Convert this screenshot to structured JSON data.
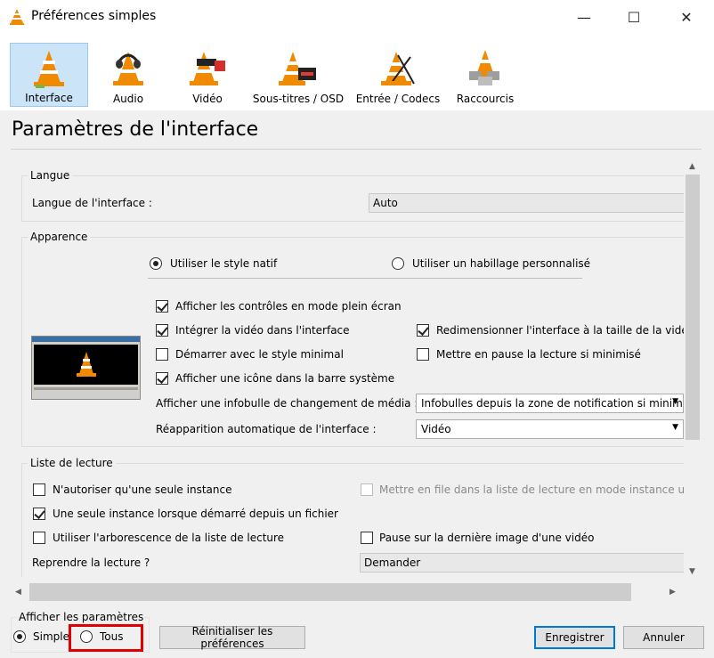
{
  "window": {
    "title": "Préférences simples",
    "minimize": "—",
    "maximize": "☐",
    "close": "✕"
  },
  "tabs": [
    {
      "label": "Interface",
      "icon": "interface-cone-icon",
      "selected": true
    },
    {
      "label": "Audio",
      "icon": "audio-cone-icon"
    },
    {
      "label": "Vidéo",
      "icon": "video-cone-icon"
    },
    {
      "label": "Sous-titres / OSD",
      "icon": "subtitles-cone-icon"
    },
    {
      "label": "Entrée / Codecs",
      "icon": "codecs-cone-icon"
    },
    {
      "label": "Raccourcis",
      "icon": "hotkeys-cone-icon"
    }
  ],
  "section_title": "Paramètres de l'interface",
  "langue": {
    "group": "Langue",
    "label": "Langue de l'interface :",
    "value": "Auto"
  },
  "apparence": {
    "group": "Apparence",
    "radio_native": "Utiliser le style natif",
    "radio_skin": "Utiliser un habillage personnalisé",
    "cb_fullscreen": "Afficher les contrôles en mode plein écran",
    "cb_embed": "Intégrer la vidéo dans l'interface",
    "cb_resize": "Redimensionner l'interface à la taille de la vidéo",
    "cb_minimal": "Démarrer avec le style minimal",
    "cb_pause_min": "Mettre en pause la lecture si minimisé",
    "cb_systray": "Afficher une icône dans la barre système",
    "tooltip_label": "Afficher une infobulle de changement de média :",
    "tooltip_value": "Infobulles depuis la zone de notification si minim",
    "raise_label": "Réapparition automatique de l'interface :",
    "raise_value": "Vidéo"
  },
  "playlist": {
    "group": "Liste de lecture",
    "cb_one_instance": "N'autoriser qu'une seule instance",
    "cb_enqueue": "Mettre en file dans la liste de lecture en mode instance uniq",
    "cb_one_instance_file": "Une seule instance lorsque démarré depuis un fichier",
    "cb_tree": "Utiliser l'arborescence de la liste de lecture",
    "cb_pause_last": "Pause sur la dernière image d'une vidéo",
    "resume_label": "Reprendre la lecture ?",
    "resume_value": "Demander"
  },
  "footer": {
    "show_settings": "Afficher les paramètres",
    "simple": "Simple",
    "all": "Tous",
    "reset": "Réinitialiser les préférences",
    "save": "Enregistrer",
    "cancel": "Annuler"
  },
  "colors": {
    "vlc_orange": "#f08a00",
    "selected_tab": "#cce4f7",
    "highlight": "#e00000",
    "default_button": "#0078d7"
  }
}
